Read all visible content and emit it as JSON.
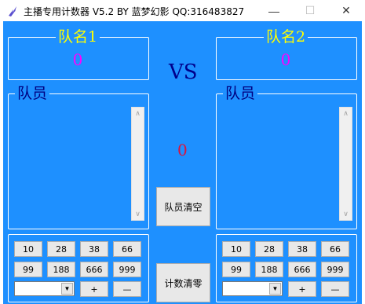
{
  "window": {
    "title": "主播专用计数器 V5.2 BY 蓝梦幻影 QQ:316483827",
    "minimize_glyph": "—",
    "maximize_glyph": "☐",
    "close_glyph": "✕"
  },
  "team1": {
    "name": "队名1",
    "score": "0",
    "members_label": "队员"
  },
  "team2": {
    "name": "队名2",
    "score": "0",
    "members_label": "队员"
  },
  "center": {
    "vs": "VS",
    "score": "0",
    "clear_members_label": "队员清空",
    "clear_count_label": "计数清零"
  },
  "left_buttons": [
    "10",
    "28",
    "38",
    "66",
    "99",
    "188",
    "666",
    "999"
  ],
  "right_buttons": [
    "10",
    "28",
    "38",
    "66",
    "99",
    "188",
    "666",
    "999"
  ],
  "plus_label": "+",
  "minus_label": "—",
  "combo_arrow": "▼",
  "scroll_up": "∧",
  "scroll_down": "∨",
  "colors": {
    "background": "#1e90ff",
    "team_name": "#ffff00",
    "score": "#ff00ff",
    "vs": "#00008b",
    "center_score": "#dc143c"
  }
}
